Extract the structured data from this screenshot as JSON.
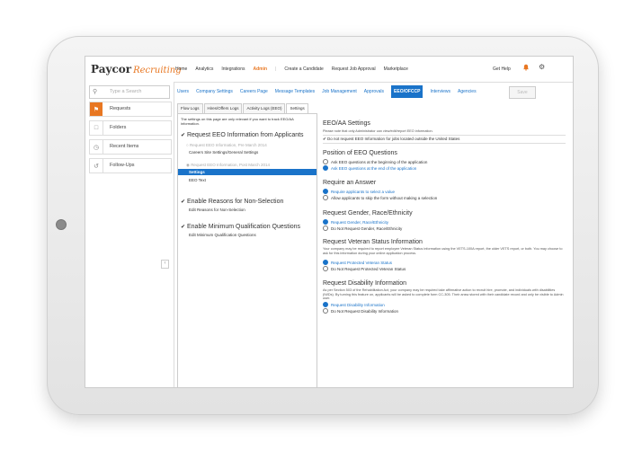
{
  "app": {
    "logo_main": "Paycor",
    "logo_script": "Recruiting",
    "nav": [
      "Home",
      "Analytics",
      "Integrations",
      "Admin",
      "Create a Candidate",
      "Request Job Approval",
      "Marketplace"
    ],
    "get_help": "Get Help"
  },
  "sidebar": {
    "search_placeholder": "Type a Search",
    "items": [
      {
        "label": "Requests",
        "icon": "flag-icon"
      },
      {
        "label": "Folders",
        "icon": "folder-icon"
      },
      {
        "label": "Recent Items",
        "icon": "clock-icon"
      },
      {
        "label": "Follow-Ups",
        "icon": "follow-up-icon"
      }
    ]
  },
  "tabs": [
    "Users",
    "Company Settings",
    "Careers Page",
    "Message Templates",
    "Job Management",
    "Approvals",
    "EEO/OFCCP",
    "Interviews",
    "Agencies"
  ],
  "save_label": "Save",
  "subtabs": [
    "Flow Logs",
    "Hires/Offers Logs",
    "Activity Logs (EEO)",
    "Settings"
  ],
  "left": {
    "note": "The settings on this page are only relevant if you want to track EEO/AA information.",
    "sections": [
      {
        "title": "Request EEO Information from Applicants",
        "items": [
          {
            "label": "Request EEO Information, Pre March 2014",
            "dim": true
          },
          {
            "label": "Careers Site Settings/General Settings",
            "dim": false
          },
          {
            "label": "Request EEO Information, Post March 2014",
            "dim": true
          },
          {
            "label": "Settings",
            "dim": false
          },
          {
            "label": "EEO Text",
            "dim": false
          }
        ]
      },
      {
        "title": "Enable Reasons for Non-Selection",
        "items": [
          {
            "label": "Edit Reasons for Non-Selection"
          }
        ]
      },
      {
        "title": "Enable Minimum Qualification Questions",
        "items": [
          {
            "label": "Edit Minimum Qualification Questions"
          }
        ]
      }
    ]
  },
  "right": {
    "eeo_title": "EEO/AA Settings",
    "eeo_note": "Please note that only Administrator can view/edit/report EEO information.",
    "eeo_checkbox": "Do not request EEO Information for jobs located outside the United States",
    "position_title": "Position of EEO Questions",
    "position_opts": [
      "Ask EEO questions at the beginning of the application",
      "Ask EEO questions at the end of the application"
    ],
    "position_selected": 1,
    "answer_title": "Require an Answer",
    "answer_opts": [
      "Require applicants to select a value",
      "Allow applicants to skip the form without making a selection"
    ],
    "answer_selected": 0,
    "gender_title": "Request Gender, Race/Ethnicity",
    "gender_opts": [
      "Request Gender, Race/Ethnicity",
      "Do Not Request Gender, Race/Ethnicity"
    ],
    "gender_selected": 0,
    "veteran_title": "Request Veteran Status Information",
    "veteran_text": "Your company may be required to report employee Veteran Status information using the VETS-100A report, the older VETS report, or both. You may choose to ask for this information during your online application process.",
    "veteran_opts": [
      "Request Protected Veteran Status",
      "Do Not Request Protected Veteran Status"
    ],
    "veteran_selected": 0,
    "disability_title": "Request Disability Information",
    "disability_text": "As per Section 503 of the Rehabilitation Act, your company may be required take affirmative action to recruit hire, promote, and individuals with disabilities (IWDs). By turning this feature on, applicants will be asked to complete form CC-305. Their answ stored with their candidate record and only be visible to Admin user.",
    "disability_opts": [
      "Request Disability Information",
      "Do Not Request Disability Information"
    ],
    "disability_selected": 0
  },
  "colors": {
    "accent": "#e87722",
    "link": "#1a73c9"
  }
}
